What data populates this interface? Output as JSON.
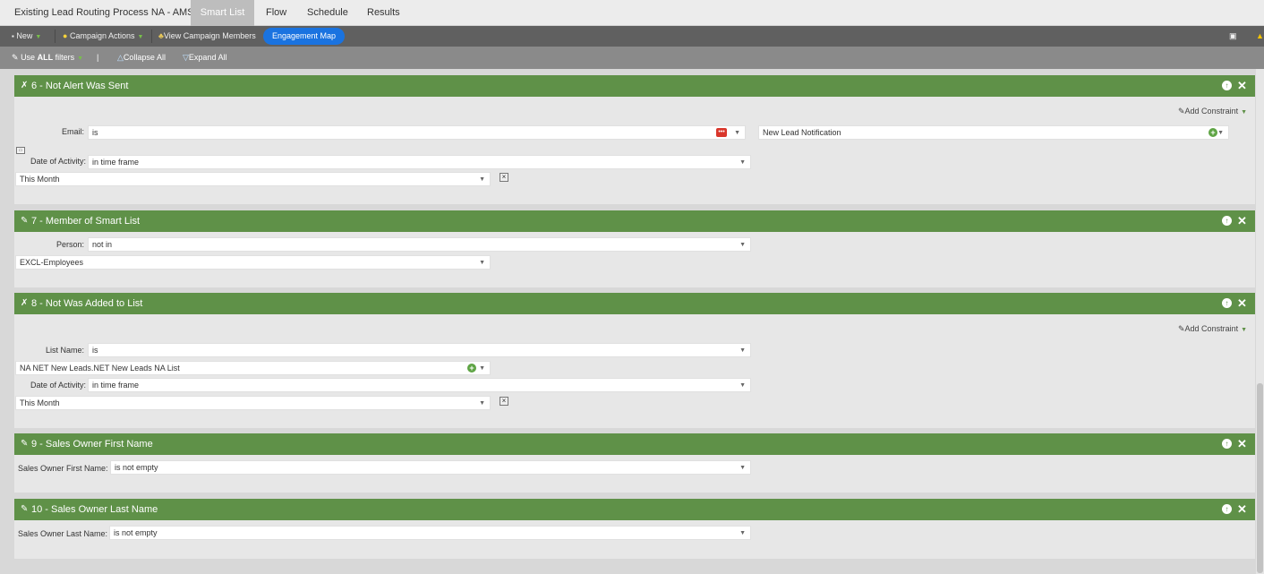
{
  "tabs": [
    {
      "label": "Existing Lead Routing Process NA - AMS"
    },
    {
      "label": "Smart List"
    },
    {
      "label": "Flow"
    },
    {
      "label": "Schedule"
    },
    {
      "label": "Results"
    }
  ],
  "toolbar": {
    "new_label": "New",
    "campaign_actions_label": "Campaign Actions",
    "view_members_label": "View Campaign Members",
    "engagement_map_label": "Engagement Map"
  },
  "filterbar": {
    "use_filters_prefix": "Use",
    "use_filters_bold": "ALL",
    "use_filters_suffix": "filters",
    "separator": "|",
    "collapse_label": "Collapse All",
    "expand_label": "Expand All"
  },
  "filters": {
    "f6": {
      "title": "6 - Not Alert Was Sent",
      "add_constraint": "Add Constraint",
      "email_label": "Email:",
      "email_op": "is",
      "email_value": "New Lead Notification",
      "doa_label": "Date of Activity:",
      "doa_op": "in time frame",
      "doa_value": "This Month"
    },
    "f7": {
      "title": "7 - Member of Smart List",
      "person_label": "Person:",
      "person_op": "not in",
      "person_value": "EXCL-Employees"
    },
    "f8": {
      "title": "8 - Not Was Added to List",
      "add_constraint": "Add Constraint",
      "list_label": "List Name:",
      "list_op": "is",
      "list_value": "NA NET New Leads.NET New Leads NA List",
      "doa_label": "Date of Activity:",
      "doa_op": "in time frame",
      "doa_value": "This Month"
    },
    "f9": {
      "title": "9 - Sales Owner First Name",
      "label": "Sales Owner First Name:",
      "op": "is not empty"
    },
    "f10": {
      "title": "10 - Sales Owner Last Name",
      "label": "Sales Owner Last Name:",
      "op": "is not empty"
    }
  },
  "colors": {
    "header_green": "#5f9148",
    "engagement_blue": "#1a73e0",
    "toolbar_gray": "#606060"
  }
}
